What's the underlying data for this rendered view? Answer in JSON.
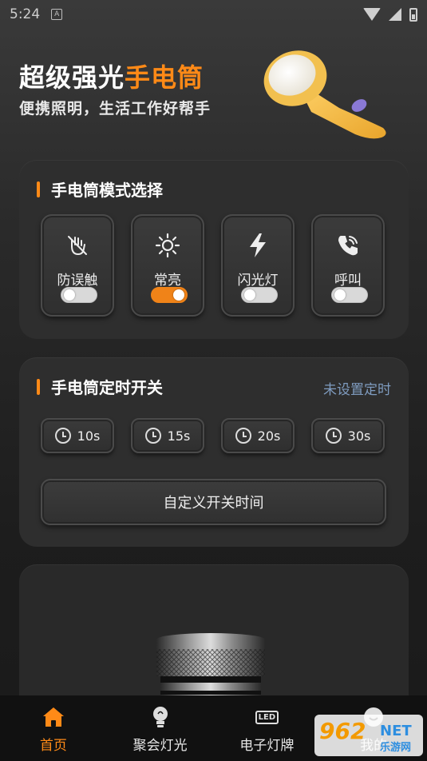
{
  "status_bar": {
    "time": "5:24",
    "notification_icon": "A"
  },
  "header": {
    "title_white": "超级强光",
    "title_accent": "手电筒",
    "subtitle": "便携照明，生活工作好帮手"
  },
  "mode_section": {
    "title": "手电筒模式选择",
    "modes": [
      {
        "label": "防误触",
        "icon": "hand-block-icon",
        "on": false
      },
      {
        "label": "常亮",
        "icon": "sun-icon",
        "on": true
      },
      {
        "label": "闪光灯",
        "icon": "lightning-icon",
        "on": false
      },
      {
        "label": "呼叫",
        "icon": "phone-call-icon",
        "on": false
      }
    ]
  },
  "timer_section": {
    "title": "手电筒定时开关",
    "status": "未设置定时",
    "options": [
      "10s",
      "15s",
      "20s",
      "30s"
    ],
    "custom_label": "自定义开关时间"
  },
  "bottom_nav": {
    "items": [
      {
        "label": "首页",
        "icon": "home-icon",
        "active": true
      },
      {
        "label": "聚会灯光",
        "icon": "bulb-icon",
        "active": false
      },
      {
        "label": "电子灯牌",
        "icon": "led-icon",
        "active": false
      },
      {
        "label": "我的",
        "icon": "profile-icon",
        "active": false
      }
    ]
  },
  "watermark": {
    "main": "962",
    "net": "NET",
    "sub": "乐游网"
  },
  "colors": {
    "accent": "#ff8a17",
    "background": "#232323",
    "card": "#2e2e2e",
    "status_blue": "#7f9cc0"
  }
}
